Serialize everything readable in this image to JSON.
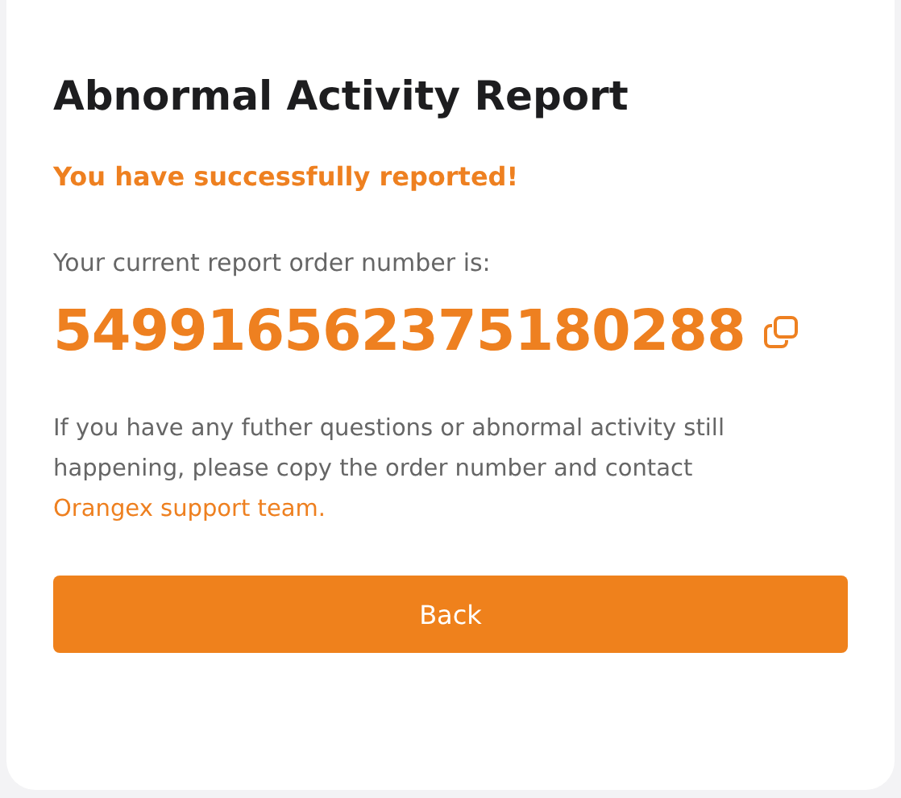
{
  "title": "Abnormal Activity Report",
  "success_message": "You have successfully reported!",
  "order_label": "Your current report order number is:",
  "order_number": "549916562375180288",
  "info": {
    "text": "If you have any futher questions or abnormal activity still happening, please copy the order number and contact",
    "link": "Orangex support team."
  },
  "button": "Back"
}
